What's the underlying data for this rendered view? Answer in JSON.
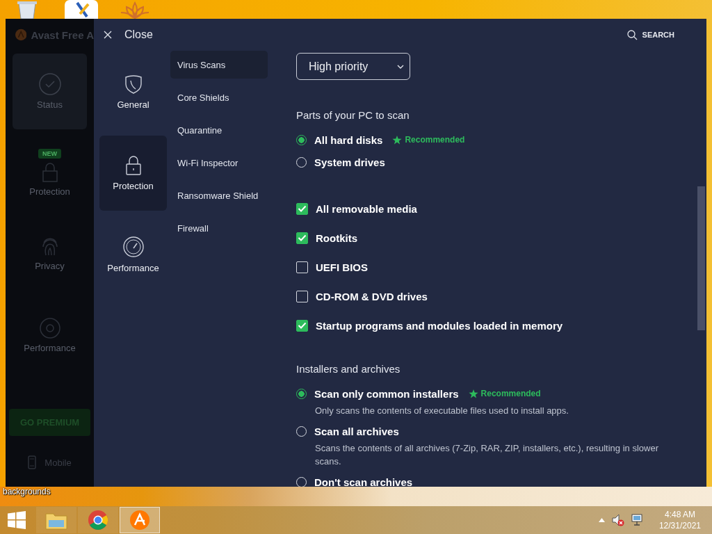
{
  "desktop": {
    "label": "backgrounds"
  },
  "app": {
    "title": "Avast Free A",
    "nav": [
      {
        "label": "Status",
        "selected": true
      },
      {
        "label": "Protection",
        "selected": false,
        "badge": "NEW"
      },
      {
        "label": "Privacy",
        "selected": false
      },
      {
        "label": "Performance",
        "selected": false
      }
    ],
    "premium_button": "GO PREMIUM",
    "mobile_link": "Mobile"
  },
  "settings": {
    "close": "Close",
    "search": "SEARCH",
    "categories": [
      {
        "label": "General",
        "selected": false
      },
      {
        "label": "Protection",
        "selected": true
      },
      {
        "label": "Performance",
        "selected": false
      }
    ],
    "subcategories": [
      {
        "label": "Virus Scans",
        "selected": true
      },
      {
        "label": "Core Shields",
        "selected": false
      },
      {
        "label": "Quarantine",
        "selected": false
      },
      {
        "label": "Wi-Fi Inspector",
        "selected": false
      },
      {
        "label": "Ransomware Shield",
        "selected": false
      },
      {
        "label": "Firewall",
        "selected": false
      }
    ],
    "priority": "High priority",
    "sections": [
      {
        "title": "Parts of your PC to scan",
        "groups": [
          {
            "kind": "radio",
            "options": [
              {
                "label": "All hard disks",
                "checked": true,
                "recommended": "Recommended"
              },
              {
                "label": "System drives",
                "checked": false
              }
            ]
          },
          {
            "kind": "checkbox",
            "options": [
              {
                "label": "All removable media",
                "checked": true
              },
              {
                "label": "Rootkits",
                "checked": true
              },
              {
                "label": "UEFI BIOS",
                "checked": false
              },
              {
                "label": "CD-ROM & DVD drives",
                "checked": false
              },
              {
                "label": "Startup programs and modules loaded in memory",
                "checked": true
              }
            ]
          }
        ]
      },
      {
        "title": "Installers and archives",
        "groups": [
          {
            "kind": "radio",
            "options": [
              {
                "label": "Scan only common installers",
                "checked": true,
                "recommended": "Recommended",
                "description": "Only scans the contents of executable files used to install apps."
              },
              {
                "label": "Scan all archives",
                "checked": false,
                "description": "Scans the contents of all archives (7-Zip, RAR, ZIP, installers, etc.), resulting in slower scans."
              },
              {
                "label": "Don't scan archives",
                "checked": false
              }
            ]
          }
        ]
      }
    ]
  },
  "taskbar": {
    "apps": [
      {
        "active": false
      },
      {
        "active": false
      },
      {
        "active": true
      }
    ],
    "clock": {
      "time": "4:48 AM",
      "date": "12/31/2021"
    }
  }
}
